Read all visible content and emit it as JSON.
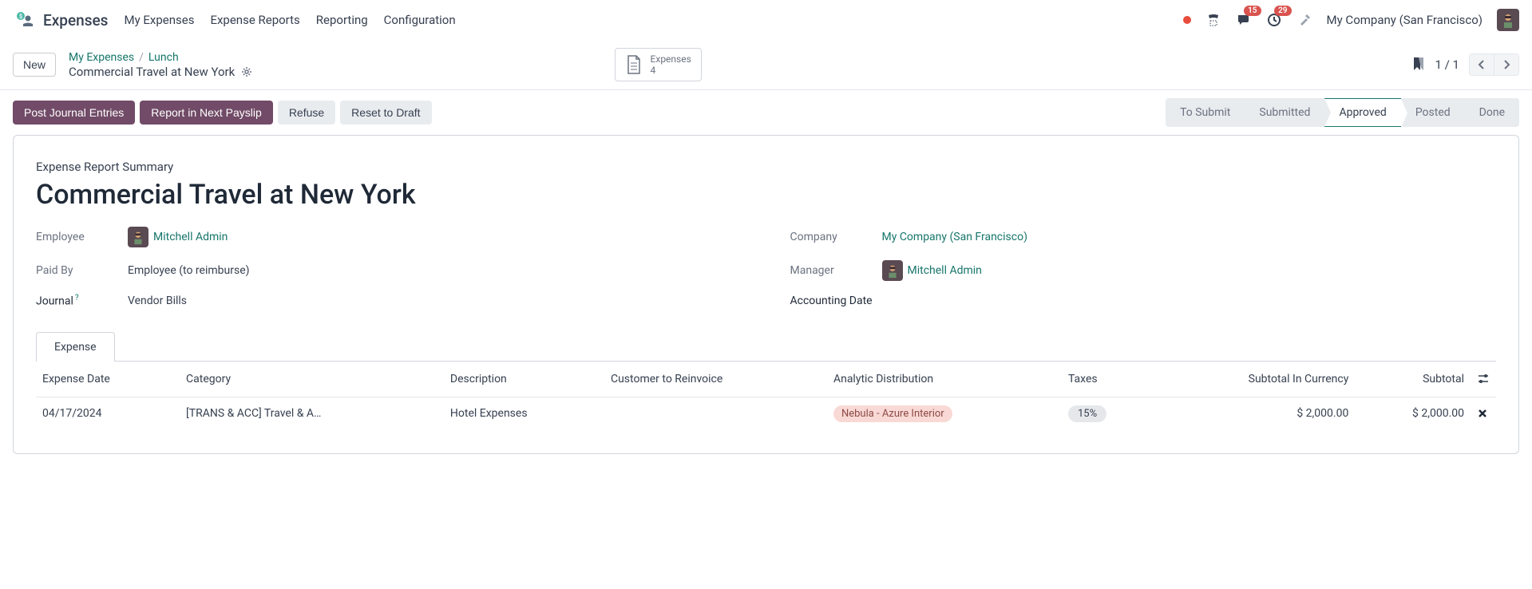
{
  "nav": {
    "app_title": "Expenses",
    "links": [
      "My Expenses",
      "Expense Reports",
      "Reporting",
      "Configuration"
    ],
    "badges": {
      "messages": "15",
      "activities": "29"
    },
    "company": "My Company (San Francisco)"
  },
  "breadcrumb": {
    "new_label": "New",
    "path": [
      "My Expenses",
      "Lunch"
    ],
    "title": "Commercial Travel at New York",
    "stat_label": "Expenses",
    "stat_count": "4",
    "pager": "1 / 1"
  },
  "actions": {
    "post": "Post Journal Entries",
    "payslip": "Report in Next Payslip",
    "refuse": "Refuse",
    "reset": "Reset to Draft"
  },
  "status": {
    "steps": [
      "To Submit",
      "Submitted",
      "Approved",
      "Posted",
      "Done"
    ],
    "active": "Approved"
  },
  "form": {
    "summary_label": "Expense Report Summary",
    "title": "Commercial Travel at New York",
    "labels": {
      "employee": "Employee",
      "company": "Company",
      "paid_by": "Paid By",
      "manager": "Manager",
      "journal": "Journal",
      "accounting_date": "Accounting Date"
    },
    "values": {
      "employee": "Mitchell Admin",
      "company": "My Company (San Francisco)",
      "paid_by": "Employee (to reimburse)",
      "manager": "Mitchell Admin",
      "journal": "Vendor Bills",
      "accounting_date": ""
    }
  },
  "tabs": {
    "expense": "Expense"
  },
  "table": {
    "headers": {
      "date": "Expense Date",
      "category": "Category",
      "description": "Description",
      "customer": "Customer to Reinvoice",
      "analytic": "Analytic Distribution",
      "taxes": "Taxes",
      "subtotal_currency": "Subtotal In Currency",
      "subtotal": "Subtotal"
    },
    "rows": [
      {
        "date": "04/17/2024",
        "category": "[TRANS & ACC] Travel & A…",
        "description": "Hotel Expenses",
        "customer": "",
        "analytic": "Nebula - Azure Interior",
        "taxes": "15%",
        "subtotal_currency": "$ 2,000.00",
        "subtotal": "$ 2,000.00"
      }
    ]
  }
}
